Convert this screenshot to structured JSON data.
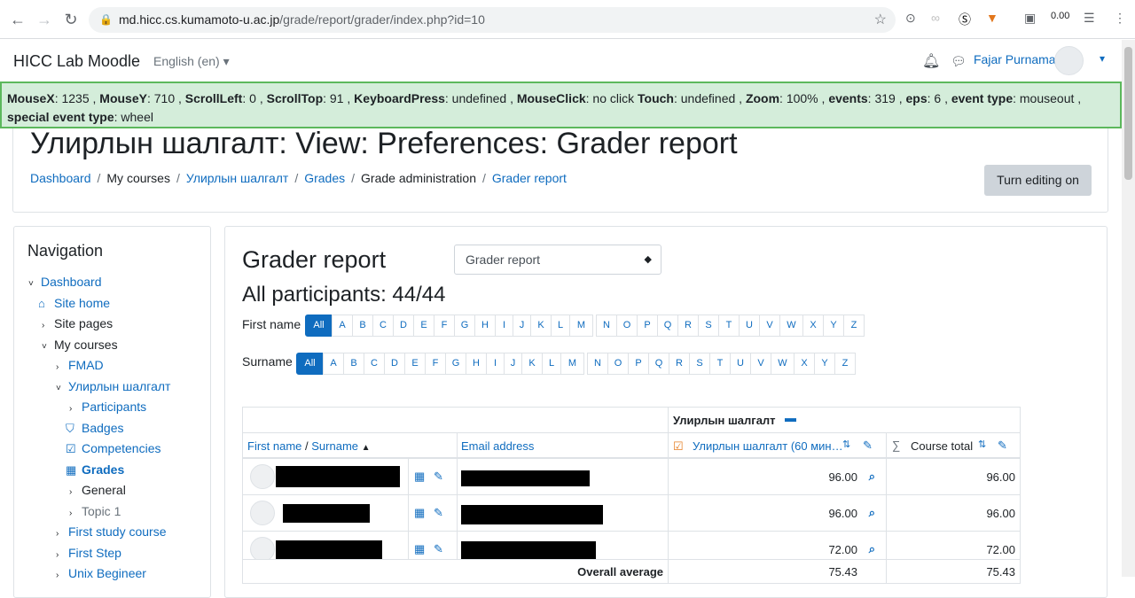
{
  "browser": {
    "url_host": "md.hicc.cs.kumamoto-u.ac.jp",
    "url_path": "/grade/report/grader/index.php?id=10",
    "ext_counter": "0.00"
  },
  "topbar": {
    "site_name": "HICC Lab Moodle",
    "language": "English (en)",
    "user_name": "Fajar Purnama"
  },
  "debug": {
    "segments": [
      {
        "k": "MouseX",
        "v": ": 1235 ,"
      },
      {
        "k": "MouseY",
        "v": ": 710 ,"
      },
      {
        "k": "ScrollLeft",
        "v": ": 0 ,"
      },
      {
        "k": "ScrollTop",
        "v": ": 91 ,"
      },
      {
        "k": "KeyboardPress",
        "v": ": undefined ,"
      },
      {
        "k": "MouseClick",
        "v": ": no click"
      },
      {
        "k": "Touch",
        "v": ": undefined ,"
      },
      {
        "k": "Zoom",
        "v": ": 100% ,"
      },
      {
        "k": "events",
        "v": ": 319 ,"
      },
      {
        "k": "eps",
        "v": ": 6 ,"
      },
      {
        "k": "event type",
        "v": ": mouseout ,"
      },
      {
        "k": "special event type",
        "v": ": wheel"
      }
    ]
  },
  "header": {
    "title": "Улирлын шалгалт: View: Preferences: Grader report",
    "breadcrumb": [
      {
        "label": "Dashboard",
        "link": true
      },
      {
        "label": "My courses",
        "link": false
      },
      {
        "label": "Улирлын шалгалт",
        "link": true
      },
      {
        "label": "Grades",
        "link": true
      },
      {
        "label": "Grade administration",
        "link": false
      },
      {
        "label": "Grader report",
        "link": true
      }
    ],
    "edit_button": "Turn editing on"
  },
  "navigation": {
    "title": "Navigation",
    "items": [
      {
        "label": "Dashboard",
        "caret": "˅",
        "icon": "",
        "style": "lnk"
      },
      {
        "label": "Site home",
        "caret": "",
        "icon": "⌂",
        "style": "lnk"
      },
      {
        "label": "Site pages",
        "caret": "›",
        "icon": "",
        "style": ""
      },
      {
        "label": "My courses",
        "caret": "˅",
        "icon": "",
        "style": ""
      },
      {
        "label": "FMAD",
        "caret": "›",
        "icon": "",
        "style": "lnk"
      },
      {
        "label": "Улирлын шалгалт",
        "caret": "˅",
        "icon": "",
        "style": "lnk"
      },
      {
        "label": "Participants",
        "caret": "›",
        "icon": "",
        "style": "lnk"
      },
      {
        "label": "Badges",
        "caret": "",
        "icon": "⛉",
        "style": "lnk"
      },
      {
        "label": "Competencies",
        "caret": "",
        "icon": "☑",
        "style": "lnk"
      },
      {
        "label": "Grades",
        "caret": "",
        "icon": "▦",
        "style": "lnk bold"
      },
      {
        "label": "General",
        "caret": "›",
        "icon": "",
        "style": ""
      },
      {
        "label": "Topic 1",
        "caret": "›",
        "icon": "",
        "style": "dim"
      },
      {
        "label": "First study course",
        "caret": "›",
        "icon": "",
        "style": "lnk"
      },
      {
        "label": "First Step",
        "caret": "›",
        "icon": "",
        "style": "lnk"
      },
      {
        "label": "Unix Begineer",
        "caret": "›",
        "icon": "",
        "style": "lnk"
      }
    ]
  },
  "main": {
    "heading": "Grader report",
    "report_select": "Grader report",
    "participants": "All participants: 44/44",
    "first_name_label": "First name",
    "surname_label": "Surname",
    "initials": [
      "All",
      "A",
      "B",
      "C",
      "D",
      "E",
      "F",
      "G",
      "H",
      "I",
      "J",
      "K",
      "L",
      "M",
      "N",
      "O",
      "P",
      "Q",
      "R",
      "S",
      "T",
      "U",
      "V",
      "W",
      "X",
      "Y",
      "Z"
    ]
  },
  "table": {
    "category_header": "Улирлын шалгалт",
    "col_name": "First name",
    "col_name_sep": " / ",
    "col_surname": "Surname",
    "col_email": "Email address",
    "col_item": "Улирлын шалгалт (60 мин…",
    "col_total": "Course total",
    "rows": [
      {
        "grade": "96.00",
        "total": "96.00"
      },
      {
        "grade": "96.00",
        "total": "96.00"
      },
      {
        "grade": "72.00",
        "total": "72.00"
      }
    ],
    "overall_label": "Overall average",
    "overall_grade": "75.43",
    "overall_total": "75.43"
  }
}
